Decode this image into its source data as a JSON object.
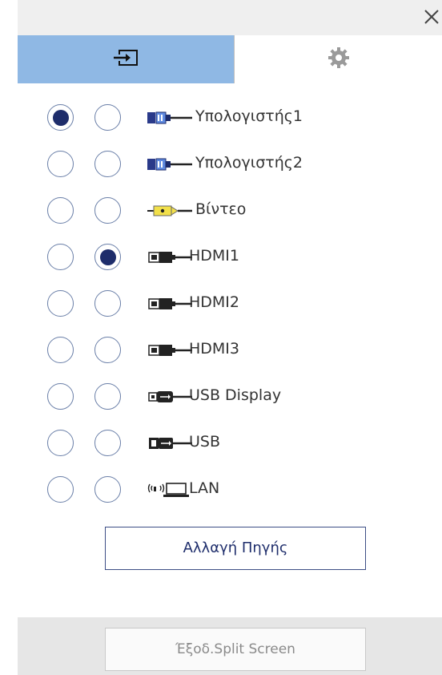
{
  "tabs": [
    {
      "id": "source",
      "icon": "input-source-icon",
      "active": true
    },
    {
      "id": "settings",
      "icon": "gear-icon",
      "active": false
    }
  ],
  "sources": [
    {
      "label": "Υπολογιστής1",
      "icon": "vga-cable-icon",
      "col1": true,
      "col2": false
    },
    {
      "label": "Υπολογιστής2",
      "icon": "vga-cable-icon",
      "col1": false,
      "col2": false
    },
    {
      "label": "Βίντεο",
      "icon": "rca-video-cable-icon",
      "col1": false,
      "col2": false
    },
    {
      "label": "HDMI1",
      "icon": "hdmi-cable-icon",
      "col1": false,
      "col2": true
    },
    {
      "label": "HDMI2",
      "icon": "hdmi-cable-icon",
      "col1": false,
      "col2": false
    },
    {
      "label": "HDMI3",
      "icon": "hdmi-cable-icon",
      "col1": false,
      "col2": false
    },
    {
      "label": "USB Display",
      "icon": "usb-display-icon",
      "col1": false,
      "col2": false
    },
    {
      "label": "USB",
      "icon": "usb-icon",
      "col1": false,
      "col2": false
    },
    {
      "label": "LAN",
      "icon": "lan-computer-icon",
      "col1": false,
      "col2": false
    }
  ],
  "buttons": {
    "change_source": "Αλλαγή Πηγής",
    "exit_split": "Έξοδ.Split Screen"
  },
  "colors": {
    "active_tab": "#8fb8e4",
    "radio_fill": "#1e2d6b",
    "radio_border": "#6a7fa8"
  }
}
